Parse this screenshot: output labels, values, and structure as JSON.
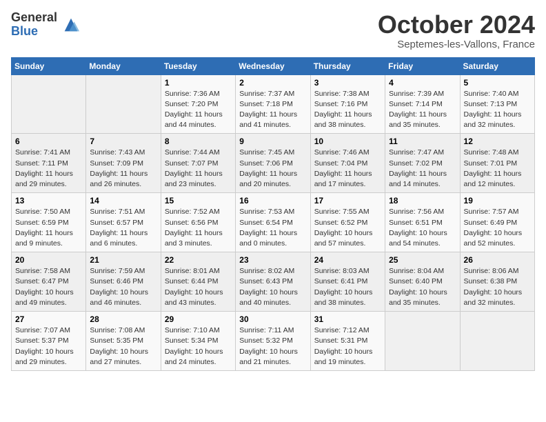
{
  "logo": {
    "general": "General",
    "blue": "Blue"
  },
  "title": "October 2024",
  "location": "Septemes-les-Vallons, France",
  "days_of_week": [
    "Sunday",
    "Monday",
    "Tuesday",
    "Wednesday",
    "Thursday",
    "Friday",
    "Saturday"
  ],
  "weeks": [
    [
      {
        "day": "",
        "sunrise": "",
        "sunset": "",
        "daylight": ""
      },
      {
        "day": "",
        "sunrise": "",
        "sunset": "",
        "daylight": ""
      },
      {
        "day": "1",
        "sunrise": "Sunrise: 7:36 AM",
        "sunset": "Sunset: 7:20 PM",
        "daylight": "Daylight: 11 hours and 44 minutes."
      },
      {
        "day": "2",
        "sunrise": "Sunrise: 7:37 AM",
        "sunset": "Sunset: 7:18 PM",
        "daylight": "Daylight: 11 hours and 41 minutes."
      },
      {
        "day": "3",
        "sunrise": "Sunrise: 7:38 AM",
        "sunset": "Sunset: 7:16 PM",
        "daylight": "Daylight: 11 hours and 38 minutes."
      },
      {
        "day": "4",
        "sunrise": "Sunrise: 7:39 AM",
        "sunset": "Sunset: 7:14 PM",
        "daylight": "Daylight: 11 hours and 35 minutes."
      },
      {
        "day": "5",
        "sunrise": "Sunrise: 7:40 AM",
        "sunset": "Sunset: 7:13 PM",
        "daylight": "Daylight: 11 hours and 32 minutes."
      }
    ],
    [
      {
        "day": "6",
        "sunrise": "Sunrise: 7:41 AM",
        "sunset": "Sunset: 7:11 PM",
        "daylight": "Daylight: 11 hours and 29 minutes."
      },
      {
        "day": "7",
        "sunrise": "Sunrise: 7:43 AM",
        "sunset": "Sunset: 7:09 PM",
        "daylight": "Daylight: 11 hours and 26 minutes."
      },
      {
        "day": "8",
        "sunrise": "Sunrise: 7:44 AM",
        "sunset": "Sunset: 7:07 PM",
        "daylight": "Daylight: 11 hours and 23 minutes."
      },
      {
        "day": "9",
        "sunrise": "Sunrise: 7:45 AM",
        "sunset": "Sunset: 7:06 PM",
        "daylight": "Daylight: 11 hours and 20 minutes."
      },
      {
        "day": "10",
        "sunrise": "Sunrise: 7:46 AM",
        "sunset": "Sunset: 7:04 PM",
        "daylight": "Daylight: 11 hours and 17 minutes."
      },
      {
        "day": "11",
        "sunrise": "Sunrise: 7:47 AM",
        "sunset": "Sunset: 7:02 PM",
        "daylight": "Daylight: 11 hours and 14 minutes."
      },
      {
        "day": "12",
        "sunrise": "Sunrise: 7:48 AM",
        "sunset": "Sunset: 7:01 PM",
        "daylight": "Daylight: 11 hours and 12 minutes."
      }
    ],
    [
      {
        "day": "13",
        "sunrise": "Sunrise: 7:50 AM",
        "sunset": "Sunset: 6:59 PM",
        "daylight": "Daylight: 11 hours and 9 minutes."
      },
      {
        "day": "14",
        "sunrise": "Sunrise: 7:51 AM",
        "sunset": "Sunset: 6:57 PM",
        "daylight": "Daylight: 11 hours and 6 minutes."
      },
      {
        "day": "15",
        "sunrise": "Sunrise: 7:52 AM",
        "sunset": "Sunset: 6:56 PM",
        "daylight": "Daylight: 11 hours and 3 minutes."
      },
      {
        "day": "16",
        "sunrise": "Sunrise: 7:53 AM",
        "sunset": "Sunset: 6:54 PM",
        "daylight": "Daylight: 11 hours and 0 minutes."
      },
      {
        "day": "17",
        "sunrise": "Sunrise: 7:55 AM",
        "sunset": "Sunset: 6:52 PM",
        "daylight": "Daylight: 10 hours and 57 minutes."
      },
      {
        "day": "18",
        "sunrise": "Sunrise: 7:56 AM",
        "sunset": "Sunset: 6:51 PM",
        "daylight": "Daylight: 10 hours and 54 minutes."
      },
      {
        "day": "19",
        "sunrise": "Sunrise: 7:57 AM",
        "sunset": "Sunset: 6:49 PM",
        "daylight": "Daylight: 10 hours and 52 minutes."
      }
    ],
    [
      {
        "day": "20",
        "sunrise": "Sunrise: 7:58 AM",
        "sunset": "Sunset: 6:47 PM",
        "daylight": "Daylight: 10 hours and 49 minutes."
      },
      {
        "day": "21",
        "sunrise": "Sunrise: 7:59 AM",
        "sunset": "Sunset: 6:46 PM",
        "daylight": "Daylight: 10 hours and 46 minutes."
      },
      {
        "day": "22",
        "sunrise": "Sunrise: 8:01 AM",
        "sunset": "Sunset: 6:44 PM",
        "daylight": "Daylight: 10 hours and 43 minutes."
      },
      {
        "day": "23",
        "sunrise": "Sunrise: 8:02 AM",
        "sunset": "Sunset: 6:43 PM",
        "daylight": "Daylight: 10 hours and 40 minutes."
      },
      {
        "day": "24",
        "sunrise": "Sunrise: 8:03 AM",
        "sunset": "Sunset: 6:41 PM",
        "daylight": "Daylight: 10 hours and 38 minutes."
      },
      {
        "day": "25",
        "sunrise": "Sunrise: 8:04 AM",
        "sunset": "Sunset: 6:40 PM",
        "daylight": "Daylight: 10 hours and 35 minutes."
      },
      {
        "day": "26",
        "sunrise": "Sunrise: 8:06 AM",
        "sunset": "Sunset: 6:38 PM",
        "daylight": "Daylight: 10 hours and 32 minutes."
      }
    ],
    [
      {
        "day": "27",
        "sunrise": "Sunrise: 7:07 AM",
        "sunset": "Sunset: 5:37 PM",
        "daylight": "Daylight: 10 hours and 29 minutes."
      },
      {
        "day": "28",
        "sunrise": "Sunrise: 7:08 AM",
        "sunset": "Sunset: 5:35 PM",
        "daylight": "Daylight: 10 hours and 27 minutes."
      },
      {
        "day": "29",
        "sunrise": "Sunrise: 7:10 AM",
        "sunset": "Sunset: 5:34 PM",
        "daylight": "Daylight: 10 hours and 24 minutes."
      },
      {
        "day": "30",
        "sunrise": "Sunrise: 7:11 AM",
        "sunset": "Sunset: 5:32 PM",
        "daylight": "Daylight: 10 hours and 21 minutes."
      },
      {
        "day": "31",
        "sunrise": "Sunrise: 7:12 AM",
        "sunset": "Sunset: 5:31 PM",
        "daylight": "Daylight: 10 hours and 19 minutes."
      },
      {
        "day": "",
        "sunrise": "",
        "sunset": "",
        "daylight": ""
      },
      {
        "day": "",
        "sunrise": "",
        "sunset": "",
        "daylight": ""
      }
    ]
  ]
}
